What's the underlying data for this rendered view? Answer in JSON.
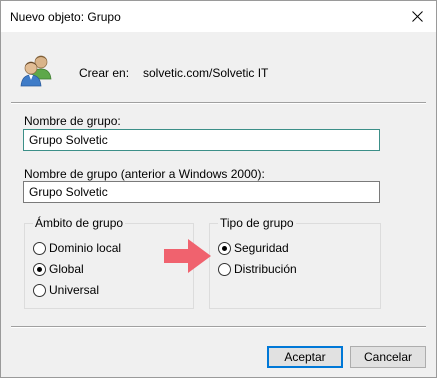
{
  "window": {
    "title": "Nuevo objeto: Grupo",
    "close_symbol": "×"
  },
  "header": {
    "icon": "group-users-icon",
    "create_label": "Crear en:",
    "create_value": "solvetic.com/Solvetic IT"
  },
  "form": {
    "group_name_label": "Nombre de grupo:",
    "group_name_value": "Grupo Solvetic",
    "group_name_pre2000_label": "Nombre de grupo (anterior a Windows 2000):",
    "group_name_pre2000_value": "Grupo Solvetic"
  },
  "scope": {
    "legend": "Ámbito de grupo",
    "options": [
      {
        "label": "Dominio local",
        "selected": false
      },
      {
        "label": "Global",
        "selected": true
      },
      {
        "label": "Universal",
        "selected": false
      }
    ]
  },
  "type": {
    "legend": "Tipo de grupo",
    "options": [
      {
        "label": "Seguridad",
        "selected": true
      },
      {
        "label": "Distribución",
        "selected": false
      }
    ]
  },
  "annotation": {
    "arrow_color": "#f0626e"
  },
  "buttons": {
    "ok": "Aceptar",
    "cancel": "Cancelar"
  },
  "colors": {
    "focus_border": "#3c8f88",
    "default_button_border": "#0078d7"
  }
}
